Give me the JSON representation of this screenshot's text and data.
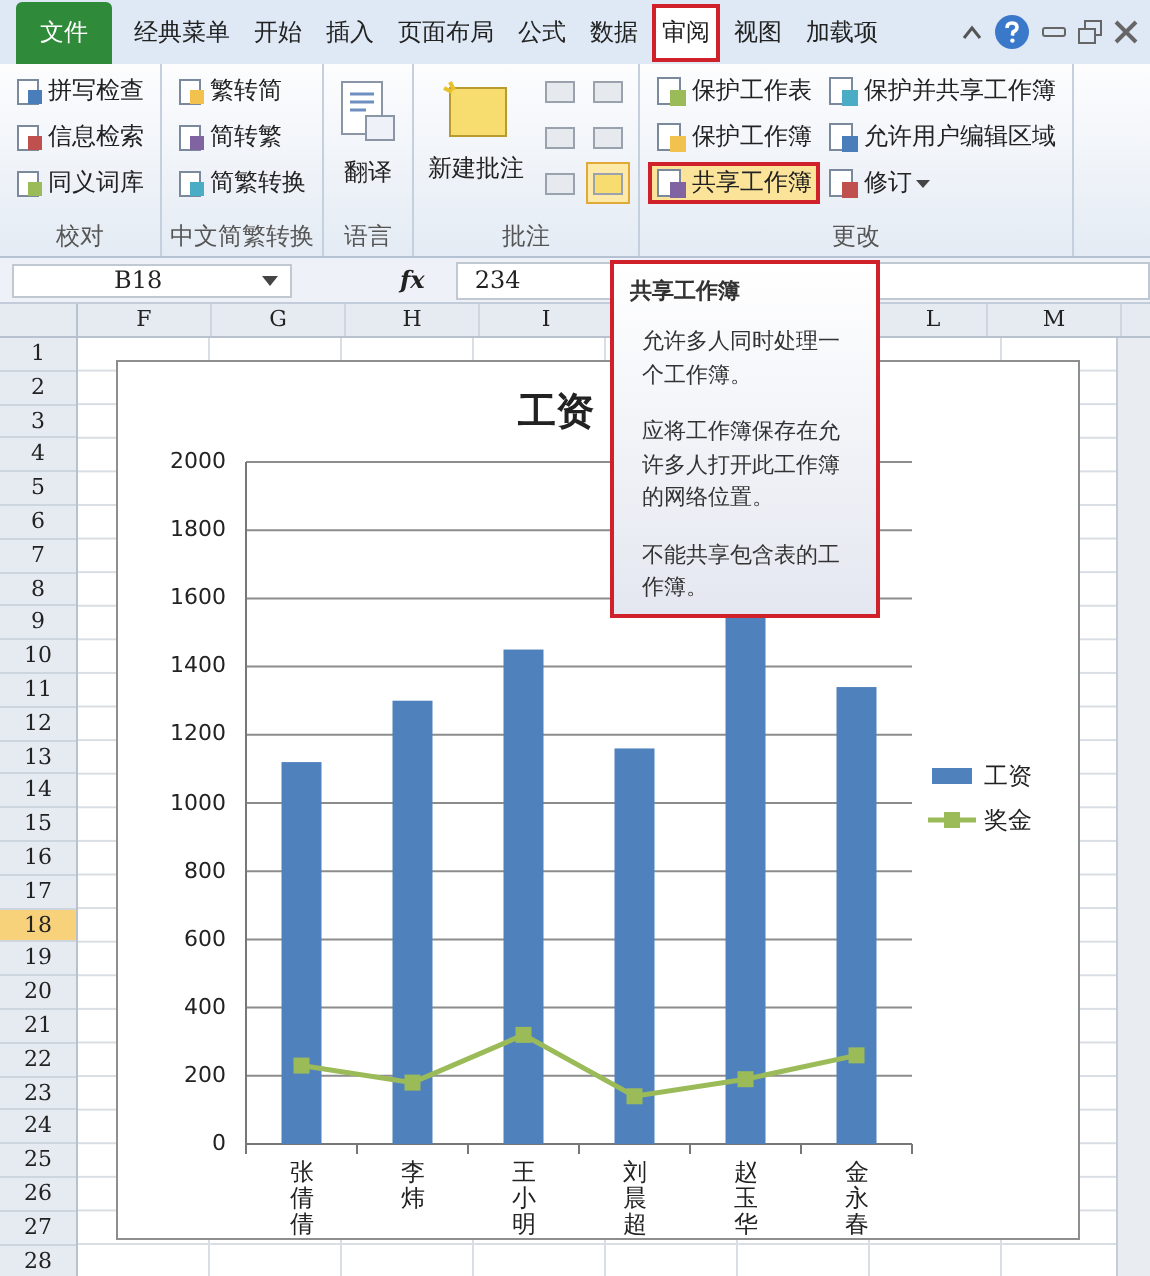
{
  "tabs": [
    {
      "label": "文件",
      "kind": "file",
      "selected": false
    },
    {
      "label": "经典菜单",
      "kind": "tab",
      "selected": false
    },
    {
      "label": "开始",
      "kind": "tab",
      "selected": false
    },
    {
      "label": "插入",
      "kind": "tab",
      "selected": false
    },
    {
      "label": "页面布局",
      "kind": "tab",
      "selected": false
    },
    {
      "label": "公式",
      "kind": "tab",
      "selected": false
    },
    {
      "label": "数据",
      "kind": "tab",
      "selected": false
    },
    {
      "label": "审阅",
      "kind": "tab",
      "selected": true
    },
    {
      "label": "视图",
      "kind": "tab",
      "selected": false
    },
    {
      "label": "加载项",
      "kind": "tab",
      "selected": false
    }
  ],
  "ribbon": {
    "groups": [
      {
        "label": "校对",
        "kind": "list",
        "buttons": [
          {
            "label": "拼写检查",
            "highlighted": false
          },
          {
            "label": "信息检索",
            "highlighted": false
          },
          {
            "label": "同义词库",
            "highlighted": false
          }
        ]
      },
      {
        "label": "中文简繁转换",
        "kind": "list",
        "buttons": [
          {
            "label": "繁转简",
            "highlighted": false
          },
          {
            "label": "简转繁",
            "highlighted": false
          },
          {
            "label": "简繁转换",
            "highlighted": false
          }
        ]
      },
      {
        "label": "语言",
        "kind": "large",
        "buttons": [
          {
            "label": "翻译",
            "highlighted": false
          }
        ]
      },
      {
        "label": "批注",
        "kind": "comments",
        "buttons": [
          {
            "label": "新建批注",
            "highlighted": false
          }
        ],
        "tools": [
          {
            "selected": false
          },
          {
            "selected": false
          },
          {
            "selected": false
          },
          {
            "selected": false
          },
          {
            "selected": false
          },
          {
            "selected": true
          }
        ]
      },
      {
        "label": "更改",
        "kind": "columns",
        "buttons": [
          {
            "label": "保护工作表",
            "highlighted": false
          },
          {
            "label": "保护工作簿",
            "highlighted": false
          },
          {
            "label": "共享工作簿",
            "highlighted": true
          },
          {
            "label": "保护并共享工作簿",
            "highlighted": false
          },
          {
            "label": "允许用户编辑区域",
            "highlighted": false
          },
          {
            "label": "修订",
            "highlighted": false,
            "dropdown": true
          }
        ]
      }
    ]
  },
  "formula_bar": {
    "name_box": "B18",
    "function_label": "fx",
    "value": "234"
  },
  "columns": [
    "F",
    "G",
    "H",
    "I",
    "L",
    "M"
  ],
  "rows": [
    {
      "label": "1",
      "selected": false
    },
    {
      "label": "2",
      "selected": false
    },
    {
      "label": "3",
      "selected": false
    },
    {
      "label": "4",
      "selected": false
    },
    {
      "label": "5",
      "selected": false
    },
    {
      "label": "6",
      "selected": false
    },
    {
      "label": "7",
      "selected": false
    },
    {
      "label": "8",
      "selected": false
    },
    {
      "label": "9",
      "selected": false
    },
    {
      "label": "10",
      "selected": false
    },
    {
      "label": "11",
      "selected": false
    },
    {
      "label": "12",
      "selected": false
    },
    {
      "label": "13",
      "selected": false
    },
    {
      "label": "14",
      "selected": false
    },
    {
      "label": "15",
      "selected": false
    },
    {
      "label": "16",
      "selected": false
    },
    {
      "label": "17",
      "selected": false
    },
    {
      "label": "18",
      "selected": true
    },
    {
      "label": "19",
      "selected": false
    },
    {
      "label": "20",
      "selected": false
    },
    {
      "label": "21",
      "selected": false
    },
    {
      "label": "22",
      "selected": false
    },
    {
      "label": "23",
      "selected": false
    },
    {
      "label": "24",
      "selected": false
    },
    {
      "label": "25",
      "selected": false
    },
    {
      "label": "26",
      "selected": false
    },
    {
      "label": "27",
      "selected": false
    },
    {
      "label": "28",
      "selected": false
    }
  ],
  "chart": {
    "chart_data": {
      "type": "bar",
      "title": "工资",
      "categories": [
        "张倩倩",
        "李炜",
        "王小明",
        "刘晨超",
        "赵玉华",
        "金永春"
      ],
      "series": [
        {
          "name": "工资",
          "type": "bar",
          "color": "#4f81bd",
          "values": [
            1120,
            1300,
            1450,
            1160,
            1550,
            1340
          ]
        },
        {
          "name": "奖金",
          "type": "line",
          "color": "#9bbb59",
          "marker": "square",
          "values": [
            230,
            180,
            320,
            140,
            190,
            260
          ]
        }
      ],
      "stacked": false,
      "grid": true,
      "legend": "right",
      "ylim": [
        0,
        2000
      ],
      "yticks": [
        0,
        200,
        400,
        600,
        800,
        1000,
        1200,
        1400,
        1600,
        1800,
        2000
      ]
    }
  },
  "tooltip": {
    "title": "共享工作簿",
    "paragraphs": [
      "允许多人同时处理一个工作簿。",
      "应将工作簿保存在允许多人打开此工作簿的网络位置。",
      "不能共享包含表的工作簿。"
    ]
  }
}
